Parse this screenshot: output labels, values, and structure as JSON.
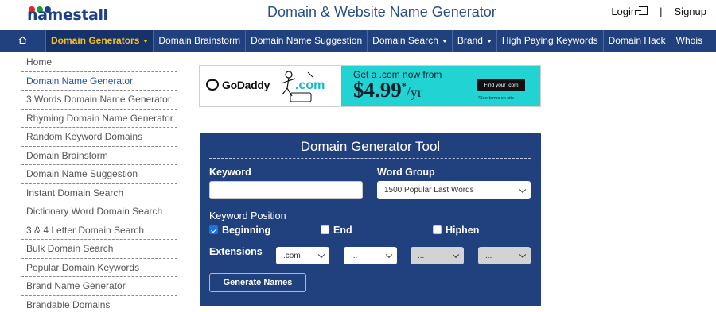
{
  "brand": {
    "logo_text": "namestall",
    "dot_colors": [
      "#e4242b",
      "#1d9c3a",
      "#1e3e86"
    ]
  },
  "header": {
    "title": "Domain & Website Name Generator",
    "login_label": "Login",
    "separator": "|",
    "signup_label": "Signup"
  },
  "nav": {
    "home_icon": "home-icon",
    "items": [
      {
        "label": "Domain Generators",
        "has_caret": true,
        "active": true
      },
      {
        "label": "Domain Brainstorm"
      },
      {
        "label": "Domain Name Suggestion"
      },
      {
        "label": "Domain Search",
        "has_caret": true
      },
      {
        "label": "Brand",
        "has_caret": true
      },
      {
        "label": "High Paying Keywords"
      },
      {
        "label": "Domain Hack"
      },
      {
        "label": "Whois"
      }
    ]
  },
  "sidebar": {
    "items": [
      {
        "label": "Home"
      },
      {
        "label": "Domain Name Generator",
        "current": true
      },
      {
        "label": "3 Words Domain Name Generator"
      },
      {
        "label": "Rhyming Domain Name Generator"
      },
      {
        "label": "Random Keyword Domains"
      },
      {
        "label": "Domain Brainstorm"
      },
      {
        "label": "Domain Name Suggestion"
      },
      {
        "label": "Instant Domain Search"
      },
      {
        "label": "Dictionary Word Domain Search"
      },
      {
        "label": "3 & 4 Letter Domain Search"
      },
      {
        "label": "Bulk Domain Search"
      },
      {
        "label": "Popular Domain Keywords"
      },
      {
        "label": "Brand Name Generator"
      },
      {
        "label": "Brandable Domains"
      }
    ]
  },
  "ad": {
    "brand": "GoDaddy",
    "graphic_text": ".com",
    "headline": "Get a .com now from",
    "price": "$4.99",
    "price_mark": "*",
    "price_unit": "/yr",
    "cta": "Find your .com",
    "terms": "*See terms on site"
  },
  "tool": {
    "title": "Domain Generator Tool",
    "keyword_label": "Keyword",
    "keyword_value": "",
    "word_group_label": "Word Group",
    "word_group_value": "1500 Popular Last Words",
    "position_label": "Keyword Position",
    "positions": [
      {
        "label": "Beginning",
        "checked": true
      },
      {
        "label": "End",
        "checked": false
      },
      {
        "label": "Hiphen",
        "checked": false
      }
    ],
    "extensions_label": "Extensions",
    "extensions": [
      ".com",
      "...",
      "...",
      "..."
    ],
    "button_label": "Generate Names"
  }
}
